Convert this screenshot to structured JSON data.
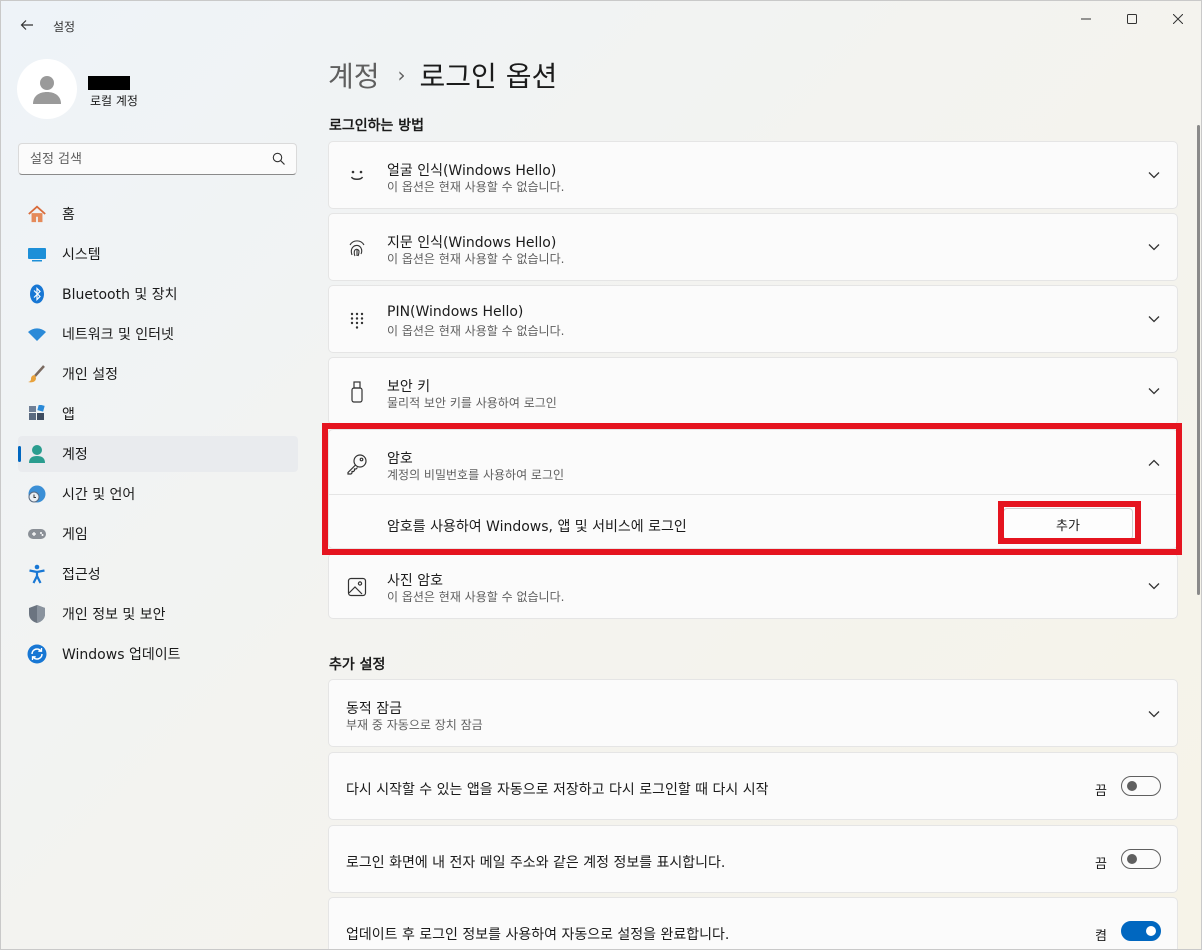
{
  "window": {
    "title": "설정",
    "controls": {
      "minimize": "minimize",
      "maximize": "maximize",
      "close": "close"
    }
  },
  "profile": {
    "account_type": "로컬 계정"
  },
  "search": {
    "placeholder": "설정 검색"
  },
  "sidebar": {
    "items": [
      {
        "label": "홈",
        "icon": "home-icon"
      },
      {
        "label": "시스템",
        "icon": "system-icon"
      },
      {
        "label": "Bluetooth 및 장치",
        "icon": "bluetooth-icon"
      },
      {
        "label": "네트워크 및 인터넷",
        "icon": "wifi-icon"
      },
      {
        "label": "개인 설정",
        "icon": "brush-icon"
      },
      {
        "label": "앱",
        "icon": "apps-icon"
      },
      {
        "label": "계정",
        "icon": "account-icon",
        "active": true
      },
      {
        "label": "시간 및 언어",
        "icon": "clock-globe-icon"
      },
      {
        "label": "게임",
        "icon": "gamepad-icon"
      },
      {
        "label": "접근성",
        "icon": "accessibility-icon"
      },
      {
        "label": "개인 정보 및 보안",
        "icon": "shield-icon"
      },
      {
        "label": "Windows 업데이트",
        "icon": "update-icon"
      }
    ]
  },
  "breadcrumb": {
    "parent": "계정",
    "separator": "›",
    "current": "로그인 옵션"
  },
  "signin_section": {
    "title": "로그인하는 방법",
    "options": [
      {
        "title": "얼굴 인식(Windows Hello)",
        "subtitle": "이 옵션은 현재 사용할 수 없습니다.",
        "icon": "face-icon"
      },
      {
        "title": "지문 인식(Windows Hello)",
        "subtitle": "이 옵션은 현재 사용할 수 없습니다.",
        "icon": "fingerprint-icon"
      },
      {
        "title": "PIN(Windows Hello)",
        "subtitle": "이 옵션은 현재 사용할 수 없습니다.",
        "icon": "keypad-icon"
      },
      {
        "title": "보안 키",
        "subtitle": "물리적 보안 키를 사용하여 로그인",
        "icon": "usb-key-icon"
      },
      {
        "title": "암호",
        "subtitle": "계정의 비밀번호를 사용하여 로그인",
        "icon": "key-icon",
        "expanded": true,
        "expanded_text": "암호를 사용하여 Windows, 앱 및 서비스에 로그인",
        "button": "추가"
      },
      {
        "title": "사진 암호",
        "subtitle": "이 옵션은 현재 사용할 수 없습니다.",
        "icon": "picture-icon"
      }
    ]
  },
  "additional_section": {
    "title": "추가 설정",
    "dynamic_lock": {
      "title": "동적 잠금",
      "subtitle": "부재 중 자동으로 장치 잠금"
    },
    "toggles": [
      {
        "label": "다시 시작할 수 있는 앱을 자동으로 저장하고 다시 로그인할 때 다시 시작",
        "state": "끔",
        "on": false
      },
      {
        "label": "로그인 화면에 내 전자 메일 주소와 같은 계정 정보를 표시합니다.",
        "state": "끔",
        "on": false
      },
      {
        "label": "업데이트 후 로그인 정보를 사용하여 자동으로 설정을 완료합니다.",
        "state": "켬",
        "on": true
      }
    ]
  },
  "colors": {
    "accent": "#0067c0",
    "highlight": "#e5141f"
  }
}
